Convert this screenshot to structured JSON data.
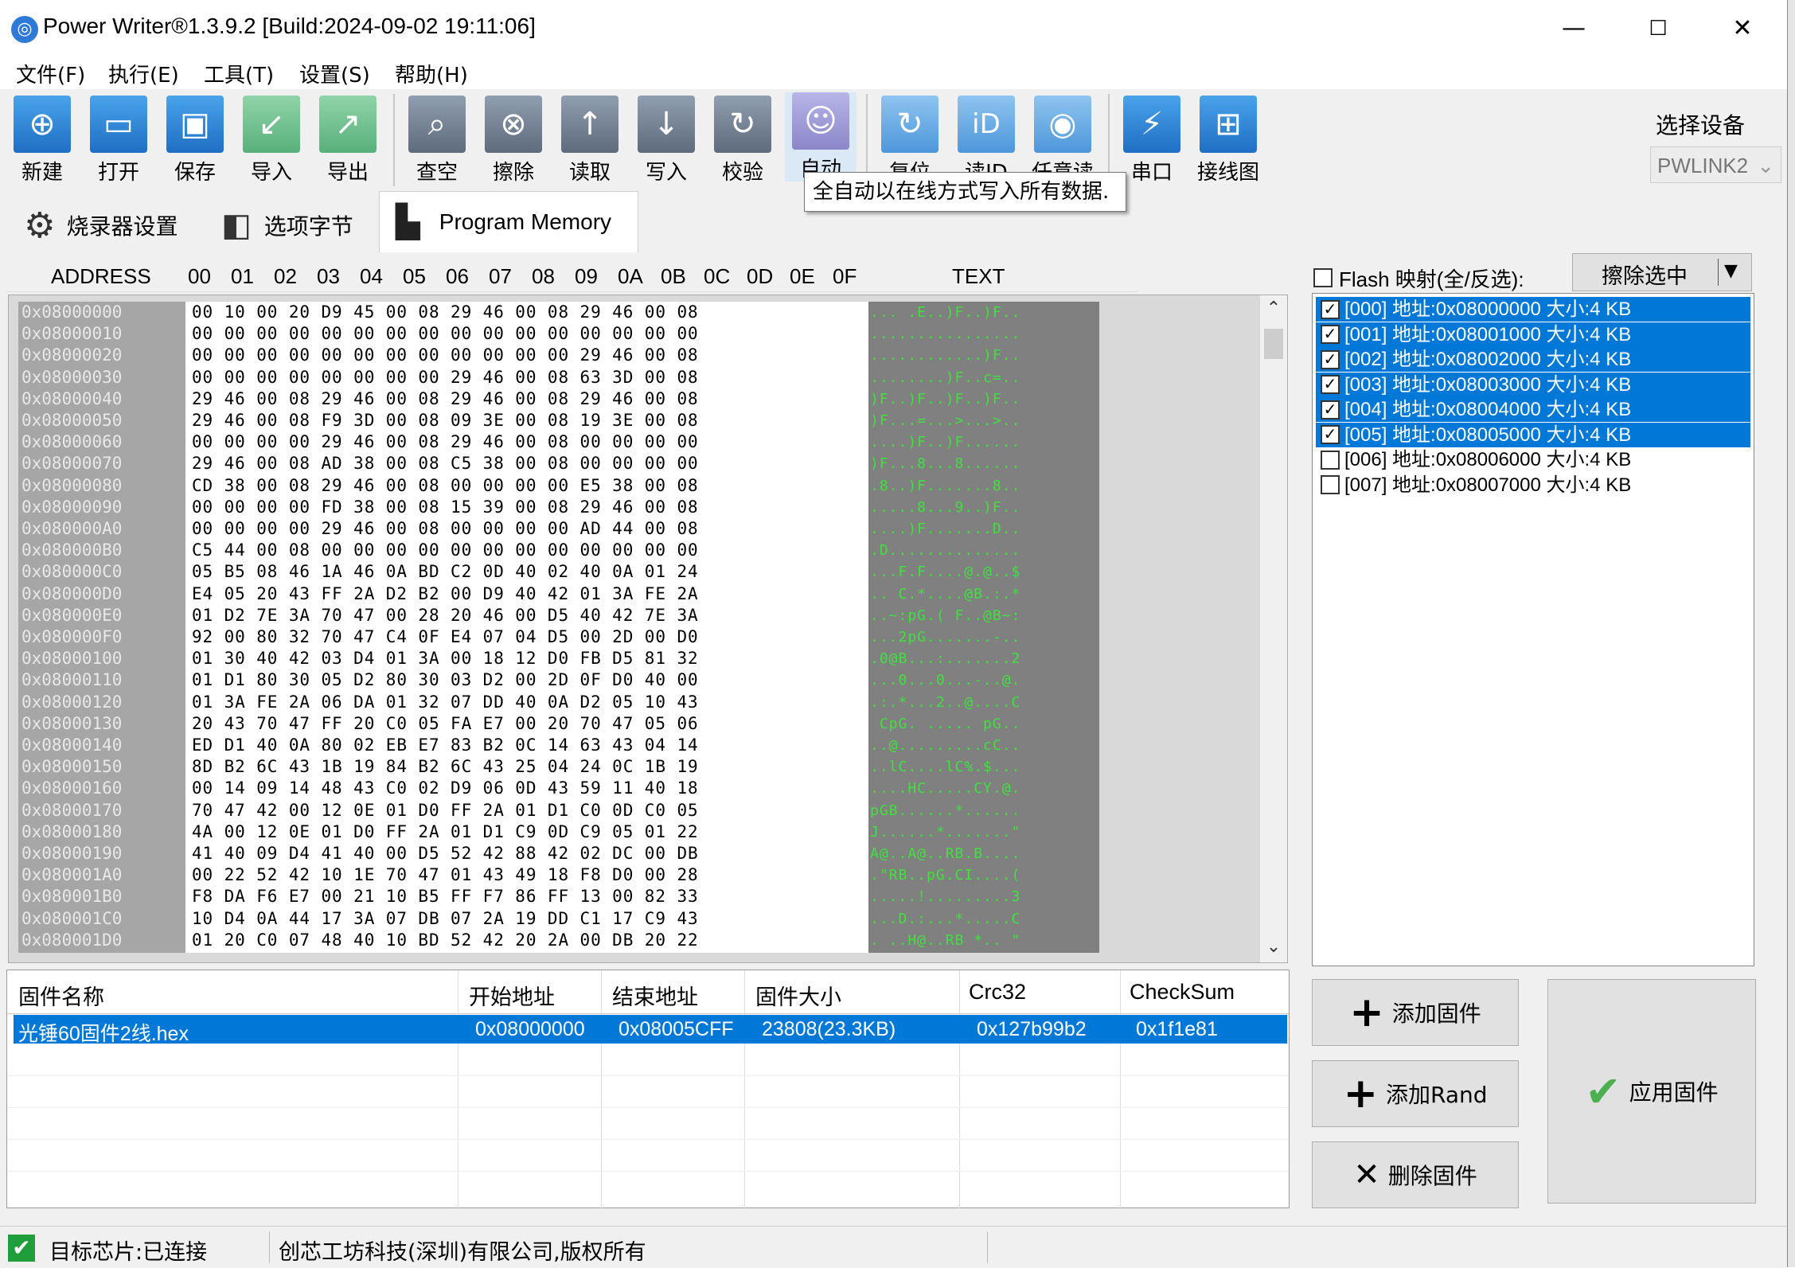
{
  "window": {
    "title": "Power Writer®1.3.9.2 [Build:2024-09-02 19:11:06]",
    "min_glyph": "—",
    "max_glyph": "☐",
    "close_glyph": "✕"
  },
  "menu": [
    "文件(F)",
    "执行(E)",
    "工具(T)",
    "设置(S)",
    "帮助(H)"
  ],
  "toolbar": {
    "buttons": [
      {
        "label": "新建",
        "icon": "new-file-icon",
        "glyph": "⊕"
      },
      {
        "label": "打开",
        "icon": "open-folder-icon",
        "glyph": "▭"
      },
      {
        "label": "保存",
        "icon": "save-icon",
        "glyph": "▣"
      },
      {
        "label": "导入",
        "icon": "import-icon",
        "glyph": "↙"
      },
      {
        "label": "导出",
        "icon": "export-icon",
        "glyph": "↗"
      },
      {
        "label": "查空",
        "icon": "search-icon",
        "glyph": "⌕"
      },
      {
        "label": "擦除",
        "icon": "erase-icon",
        "glyph": "⊗"
      },
      {
        "label": "读取",
        "icon": "read-icon",
        "glyph": "↑"
      },
      {
        "label": "写入",
        "icon": "write-icon",
        "glyph": "↓"
      },
      {
        "label": "校验",
        "icon": "verify-icon",
        "glyph": "↻"
      },
      {
        "label": "自动",
        "icon": "robot-icon",
        "glyph": "☺"
      },
      {
        "label": "复位",
        "icon": "reset-icon",
        "glyph": "↻"
      },
      {
        "label": "读ID",
        "icon": "id-icon",
        "glyph": "iD"
      },
      {
        "label": "任意读",
        "icon": "any-read-icon",
        "glyph": "◉"
      },
      {
        "label": "串口",
        "icon": "serial-port-icon",
        "glyph": "⚡"
      },
      {
        "label": "接线图",
        "icon": "wiring-diagram-icon",
        "glyph": "⊞"
      }
    ],
    "tooltip": "全自动以在线方式写入所有数据."
  },
  "device": {
    "label": "选择设备",
    "selected": "PWLINK2"
  },
  "tabs": [
    {
      "label": "烧录器设置",
      "icon": "gear-icon"
    },
    {
      "label": "选项字节",
      "icon": "settings-sliders-icon"
    },
    {
      "label": "Program Memory",
      "icon": "memory-chip-icon"
    }
  ],
  "hex": {
    "columns": [
      "ADDRESS",
      "00",
      "01",
      "02",
      "03",
      "04",
      "05",
      "06",
      "07",
      "08",
      "09",
      "0A",
      "0B",
      "0C",
      "0D",
      "0E",
      "0F",
      "TEXT"
    ],
    "rows": [
      {
        "addr": "0x08000000",
        "bytes": "00 10 00 20 D9 45 00 08 29 46 00 08 29 46 00 08",
        "text": "... .E..)F..)F.."
      },
      {
        "addr": "0x08000010",
        "bytes": "00 00 00 00 00 00 00 00 00 00 00 00 00 00 00 00",
        "text": "................"
      },
      {
        "addr": "0x08000020",
        "bytes": "00 00 00 00 00 00 00 00 00 00 00 00 29 46 00 08",
        "text": "............)F.."
      },
      {
        "addr": "0x08000030",
        "bytes": "00 00 00 00 00 00 00 00 29 46 00 08 63 3D 00 08",
        "text": "........)F..c=.."
      },
      {
        "addr": "0x08000040",
        "bytes": "29 46 00 08 29 46 00 08 29 46 00 08 29 46 00 08",
        "text": ")F..)F..)F..)F.."
      },
      {
        "addr": "0x08000050",
        "bytes": "29 46 00 08 F9 3D 00 08 09 3E 00 08 19 3E 00 08",
        "text": ")F...=...>...>.."
      },
      {
        "addr": "0x08000060",
        "bytes": "00 00 00 00 29 46 00 08 29 46 00 08 00 00 00 00",
        "text": "....)F..)F......"
      },
      {
        "addr": "0x08000070",
        "bytes": "29 46 00 08 AD 38 00 08 C5 38 00 08 00 00 00 00",
        "text": ")F...8...8......"
      },
      {
        "addr": "0x08000080",
        "bytes": "CD 38 00 08 29 46 00 08 00 00 00 00 E5 38 00 08",
        "text": ".8..)F.......8.."
      },
      {
        "addr": "0x08000090",
        "bytes": "00 00 00 00 FD 38 00 08 15 39 00 08 29 46 00 08",
        "text": ".....8...9..)F.."
      },
      {
        "addr": "0x080000A0",
        "bytes": "00 00 00 00 29 46 00 08 00 00 00 00 AD 44 00 08",
        "text": "....)F.......D.."
      },
      {
        "addr": "0x080000B0",
        "bytes": "C5 44 00 08 00 00 00 00 00 00 00 00 00 00 00 00",
        "text": ".D.............."
      },
      {
        "addr": "0x080000C0",
        "bytes": "05 B5 08 46 1A 46 0A BD C2 0D 40 02 40 0A 01 24",
        "text": "...F.F....@.@..$"
      },
      {
        "addr": "0x080000D0",
        "bytes": "E4 05 20 43 FF 2A D2 B2 00 D9 40 42 01 3A FE 2A",
        "text": ".. C.*....@B.:.*"
      },
      {
        "addr": "0x080000E0",
        "bytes": "01 D2 7E 3A 70 47 00 28 20 46 00 D5 40 42 7E 3A",
        "text": "..~:pG.( F..@B~:"
      },
      {
        "addr": "0x080000F0",
        "bytes": "92 00 80 32 70 47 C4 0F E4 07 04 D5 00 2D 00 D0",
        "text": "...2pG.......-.."
      },
      {
        "addr": "0x08000100",
        "bytes": "01 30 40 42 03 D4 01 3A 00 18 12 D0 FB D5 81 32",
        "text": ".0@B...:.......2"
      },
      {
        "addr": "0x08000110",
        "bytes": "01 D1 80 30 05 D2 80 30 03 D2 00 2D 0F D0 40 00",
        "text": "...0...0...-..@."
      },
      {
        "addr": "0x08000120",
        "bytes": "01 3A FE 2A 06 DA 01 32 07 DD 40 0A D2 05 10 43",
        "text": ".:.*...2..@....C"
      },
      {
        "addr": "0x08000130",
        "bytes": "20 43 70 47 FF 20 C0 05 FA E7 00 20 70 47 05 06",
        "text": " CpG. ..... pG.."
      },
      {
        "addr": "0x08000140",
        "bytes": "ED D1 40 0A 80 02 EB E7 83 B2 0C 14 63 43 04 14",
        "text": "..@.........cC.."
      },
      {
        "addr": "0x08000150",
        "bytes": "8D B2 6C 43 1B 19 84 B2 6C 43 25 04 24 0C 1B 19",
        "text": "..lC....lC%.$..."
      },
      {
        "addr": "0x08000160",
        "bytes": "00 14 09 14 48 43 C0 02 D9 06 0D 43 59 11 40 18",
        "text": "....HC.....CY.@."
      },
      {
        "addr": "0x08000170",
        "bytes": "70 47 42 00 12 0E 01 D0 FF 2A 01 D1 C0 0D C0 05",
        "text": "pGB......*......"
      },
      {
        "addr": "0x08000180",
        "bytes": "4A 00 12 0E 01 D0 FF 2A 01 D1 C9 0D C9 05 01 22",
        "text": "J......*.......\""
      },
      {
        "addr": "0x08000190",
        "bytes": "41 40 09 D4 41 40 00 D5 52 42 88 42 02 DC 00 DB",
        "text": "A@..A@..RB.B...."
      },
      {
        "addr": "0x080001A0",
        "bytes": "00 22 52 42 10 1E 70 47 01 43 49 18 F8 D0 00 28",
        "text": ".\"RB..pG.CI....("
      },
      {
        "addr": "0x080001B0",
        "bytes": "F8 DA F6 E7 00 21 10 B5 FF F7 86 FF 13 00 82 33",
        "text": ".....!.........3"
      },
      {
        "addr": "0x080001C0",
        "bytes": "10 D4 0A 44 17 3A 07 DB 07 2A 19 DD C1 17 C9 43",
        "text": "...D.:...*.....C"
      },
      {
        "addr": "0x080001D0",
        "bytes": "01 20 C0 07 48 40 10 BD 52 42 20 2A 00 DB 20 22",
        "text": ". ..H@..RB *.. \""
      }
    ]
  },
  "flash": {
    "header": "Flash 映射(全/反选):",
    "erase_label": "擦除选中",
    "erase_dropdown_glyph": "▼",
    "items": [
      {
        "label": "[000] 地址:0x08000000 大小:4 KB",
        "checked": true
      },
      {
        "label": "[001] 地址:0x08001000 大小:4 KB",
        "checked": true
      },
      {
        "label": "[002] 地址:0x08002000 大小:4 KB",
        "checked": true
      },
      {
        "label": "[003] 地址:0x08003000 大小:4 KB",
        "checked": true
      },
      {
        "label": "[004] 地址:0x08004000 大小:4 KB",
        "checked": true
      },
      {
        "label": "[005] 地址:0x08005000 大小:4 KB",
        "checked": true
      },
      {
        "label": "[006] 地址:0x08006000 大小:4 KB",
        "checked": false
      },
      {
        "label": "[007] 地址:0x08007000 大小:4 KB",
        "checked": false
      }
    ]
  },
  "firmware": {
    "columns": [
      "固件名称",
      "开始地址",
      "结束地址",
      "固件大小",
      "Crc32",
      "CheckSum"
    ],
    "rows": [
      [
        "光锤60固件2线.hex",
        "0x08000000",
        "0x08005CFF",
        "23808(23.3KB)",
        "0x127b99b2",
        "0x1f1e81"
      ]
    ]
  },
  "actions": {
    "add_firmware": "添加固件",
    "add_rand": "添加Rand",
    "delete_firmware": "删除固件",
    "apply_firmware": "应用固件",
    "plus_glyph": "+",
    "cross_glyph": "✕",
    "check_glyph": "✔"
  },
  "status": {
    "chip": "目标芯片:已连接",
    "copyright": "创芯工坊科技(深圳)有限公司,版权所有",
    "ok_glyph": "✔"
  },
  "colors": {
    "selection": "#0078d7",
    "hex_text": "#3fe03f",
    "apply_check": "#4caf50"
  }
}
